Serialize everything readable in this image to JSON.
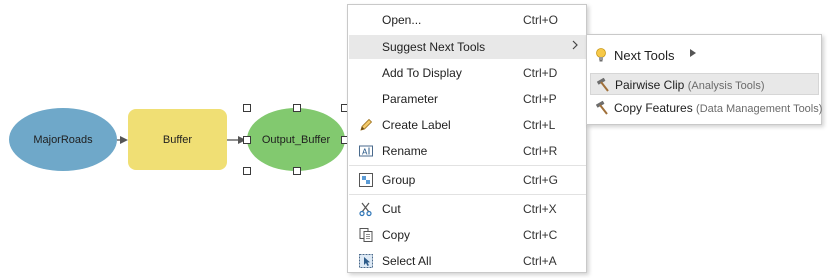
{
  "canvas": {
    "nodes": {
      "major_roads": "MajorRoads",
      "buffer": "Buffer",
      "output_buffer": "Output_Buffer"
    }
  },
  "context_menu": {
    "items": [
      {
        "label": "Open...",
        "shortcut": "Ctrl+O",
        "icon": ""
      },
      {
        "label": "Suggest Next Tools",
        "shortcut": "",
        "icon": "",
        "submenu": true
      },
      {
        "label": "Add To Display",
        "shortcut": "Ctrl+D",
        "icon": ""
      },
      {
        "label": "Parameter",
        "shortcut": "Ctrl+P",
        "icon": ""
      },
      {
        "label": "Create Label",
        "shortcut": "Ctrl+L",
        "icon": "pencil-icon"
      },
      {
        "label": "Rename",
        "shortcut": "Ctrl+R",
        "icon": "rename-icon"
      },
      {
        "label": "Group",
        "shortcut": "Ctrl+G",
        "icon": "group-icon"
      },
      {
        "label": "Cut",
        "shortcut": "Ctrl+X",
        "icon": "scissors-icon"
      },
      {
        "label": "Copy",
        "shortcut": "Ctrl+C",
        "icon": "copy-icon"
      },
      {
        "label": "Select All",
        "shortcut": "Ctrl+A",
        "icon": "select-all-icon"
      }
    ]
  },
  "submenu": {
    "header": "Next Tools",
    "tools": [
      {
        "name": "Pairwise Clip",
        "category": "(Analysis Tools)"
      },
      {
        "name": "Copy Features",
        "category": "(Data Management Tools)"
      }
    ]
  },
  "colors": {
    "major_roads": "#6fa8c9",
    "buffer": "#f0df74",
    "output_buffer": "#82c96f",
    "highlight": "#e8e8e8"
  }
}
